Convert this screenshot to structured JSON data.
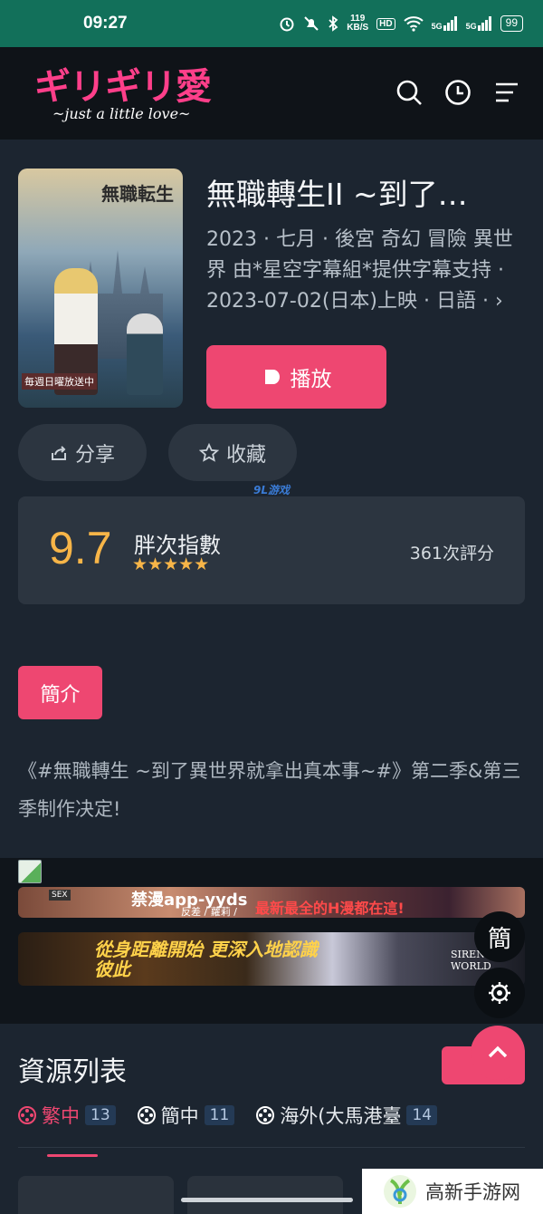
{
  "status_bar": {
    "time": "09:27",
    "net_speed_value": "119",
    "net_speed_unit": "KB/S",
    "hd": "HD",
    "sig1": "5G",
    "sig2": "5G",
    "battery": "99"
  },
  "header": {
    "logo_text_a": "ギリギリ",
    "logo_text_b": "愛",
    "logo_tagline": "~just a little love~",
    "icons": [
      "search-icon",
      "history-icon",
      "menu-icon"
    ]
  },
  "anime": {
    "poster_title": "無職転生",
    "poster_footer": "毎週日曜放送中",
    "title": "無職轉生II ~到了…",
    "meta": "2023 · 七月 · 後宮 奇幻 冒險 異世界 由*星空字幕組*提供字幕支持 · 2023-07-02(日本)上映 · 日語 · ›",
    "play_label": "播放",
    "share_label": "分享",
    "fav_label": "收藏"
  },
  "watermark": "9L游戏",
  "rating": {
    "score": "9.7",
    "label": "胖次指數",
    "stars": "★★★★★",
    "count": "361次評分"
  },
  "intro": {
    "button_label": "簡介",
    "text": "《#無職轉生 ~到了異世界就拿出真本事~#》第二季&第三季制作决定!"
  },
  "ads": {
    "banner1_title": "禁漫app-yyds",
    "banner1_sub": "反差 / 蘿莉 /",
    "banner1_red": "最新最全的H漫都在這!",
    "banner1_badge": "SEX",
    "banner2_text": "從身距離開始 更深入地認識彼此",
    "banner2_right": "SIREN WORLD"
  },
  "float": {
    "lang_label": "簡",
    "icons": [
      "settings-icon",
      "chevron-up-icon"
    ]
  },
  "resources": {
    "title": "資源列表",
    "sort_label": "⇅",
    "tabs": [
      {
        "label": "繁中",
        "count": "13"
      },
      {
        "label": "簡中",
        "count": "11"
      },
      {
        "label": "海外(大馬港臺",
        "count": "14"
      }
    ]
  },
  "brand": {
    "text": "高新手游网"
  },
  "colors": {
    "accent": "#ee4771",
    "rating": "#f7b548",
    "bg": "#1c2530",
    "status": "#12705a"
  }
}
